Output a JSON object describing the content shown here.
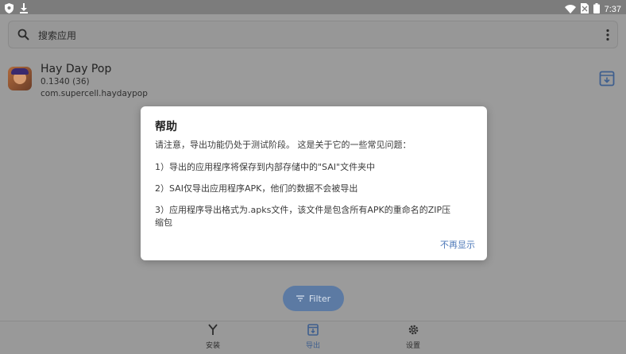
{
  "status_bar": {
    "time": "7:37",
    "left_icons": [
      "shield-icon",
      "download-icon"
    ],
    "right_icons": [
      "wifi-icon",
      "no-sim-icon",
      "battery-icon"
    ]
  },
  "search": {
    "placeholder": "搜索应用",
    "menu_icon": "more-vert-icon"
  },
  "app_list": [
    {
      "name": "Hay Day Pop",
      "version": "0.1340 (36)",
      "package": "com.supercell.haydaypop"
    }
  ],
  "filter_button": {
    "label": "Filter"
  },
  "bottom_nav": [
    {
      "label": "安装",
      "icon": "install-icon"
    },
    {
      "label": "导出",
      "icon": "export-icon",
      "active": true
    },
    {
      "label": "设置",
      "icon": "gear-icon"
    }
  ],
  "dialog": {
    "title": "帮助",
    "intro": "请注意，导出功能仍处于测试阶段。 这是关于它的一些常见问题：",
    "item1": "1）导出的应用程序将保存到内部存储中的\"SAI\"文件夹中",
    "item2": "2）SAI仅导出应用程序APK，他们的数据不会被导出",
    "item3_line1": "3）应用程序导出格式为.apks文件，该文件是包含所有APK的重命名的ZIP压",
    "item3_line2": "缩包",
    "action": "不再显示"
  },
  "colors": {
    "accent": "#4d78b8",
    "scrim_background": "#9b9b9b",
    "dialog_background": "#ffffff"
  }
}
